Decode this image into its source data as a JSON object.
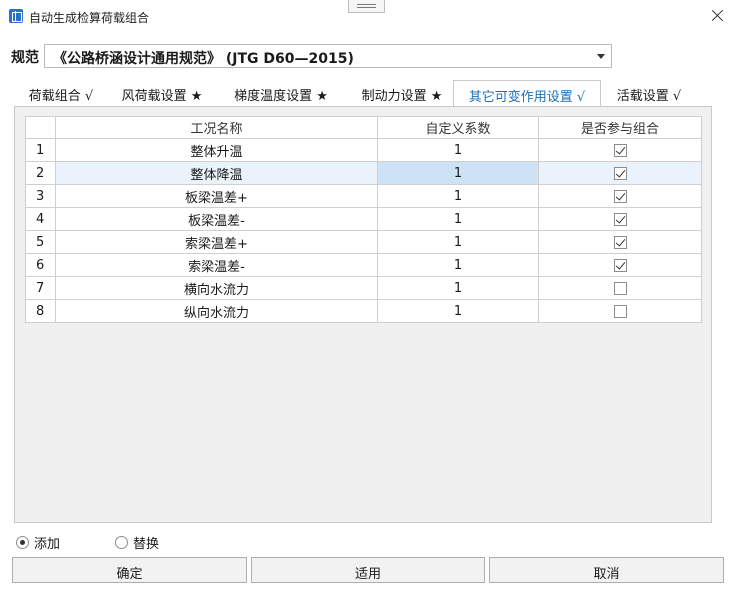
{
  "window": {
    "title": "自动生成检算荷载组合",
    "app_icon": "app-icon",
    "close_icon": "close-icon"
  },
  "spec": {
    "label": "规范",
    "value": "《公路桥涵设计通用规范》 (JTG D60—2015)"
  },
  "tabs": [
    {
      "label": "荷载组合 √",
      "active": false
    },
    {
      "label": "风荷载设置 ★",
      "active": false
    },
    {
      "label": "梯度温度设置 ★",
      "active": false
    },
    {
      "label": "制动力设置 ★",
      "active": false
    },
    {
      "label": "其它可变作用设置 √",
      "active": true
    },
    {
      "label": "活载设置 √",
      "active": false
    }
  ],
  "table": {
    "columns": [
      "",
      "工况名称",
      "自定义系数",
      "是否参与组合"
    ],
    "rows": [
      {
        "index": "1",
        "name": "整体升温",
        "factor": "1",
        "included": true
      },
      {
        "index": "2",
        "name": "整体降温",
        "factor": "1",
        "included": true,
        "selected": true
      },
      {
        "index": "3",
        "name": "板梁温差+",
        "factor": "1",
        "included": true
      },
      {
        "index": "4",
        "name": "板梁温差-",
        "factor": "1",
        "included": true
      },
      {
        "index": "5",
        "name": "索梁温差+",
        "factor": "1",
        "included": true
      },
      {
        "index": "6",
        "name": "索梁温差-",
        "factor": "1",
        "included": true
      },
      {
        "index": "7",
        "name": "横向水流力",
        "factor": "1",
        "included": false
      },
      {
        "index": "8",
        "name": "纵向水流力",
        "factor": "1",
        "included": false
      }
    ]
  },
  "mode": {
    "add_label": "添加",
    "replace_label": "替换",
    "selected": "add"
  },
  "buttons": {
    "ok": "确定",
    "apply": "适用",
    "cancel": "取消"
  },
  "colors": {
    "active_tab_text": "#1c6fb5",
    "selected_cell": "#cde3f5"
  }
}
